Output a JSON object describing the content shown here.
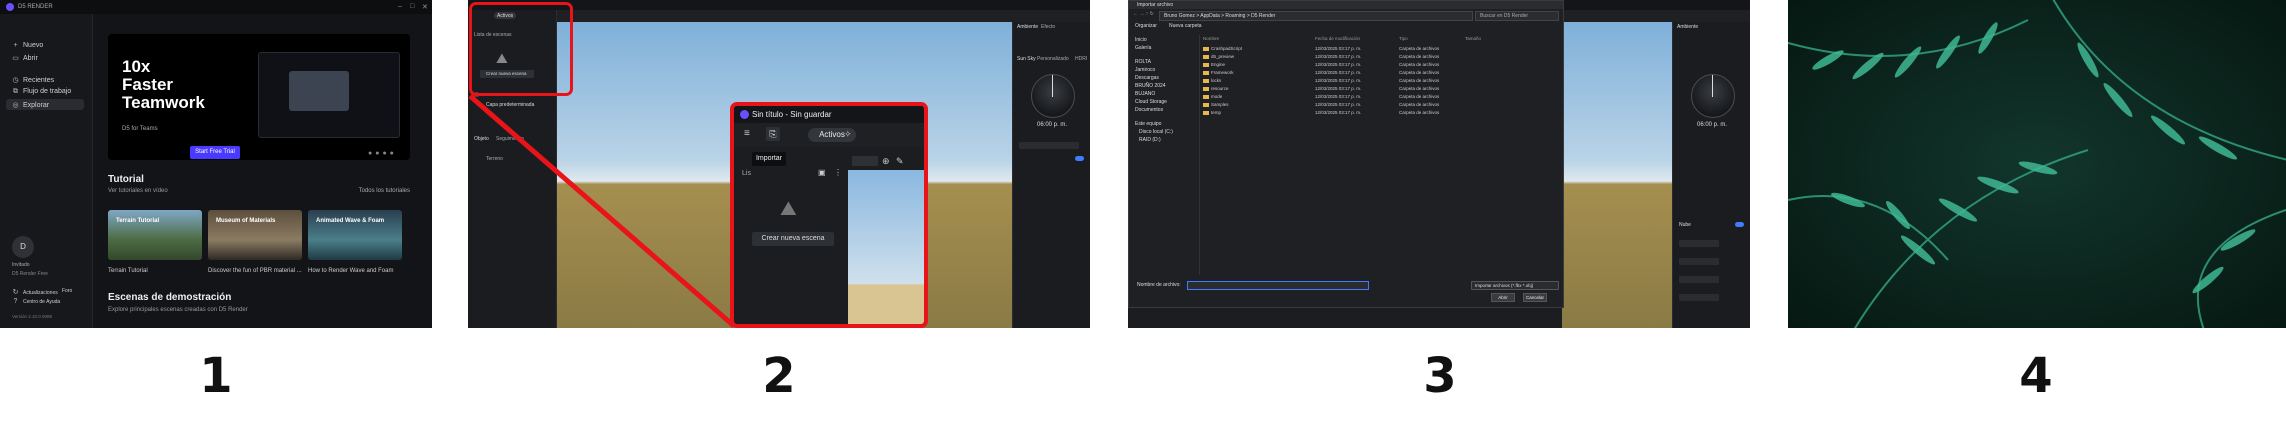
{
  "panel1": {
    "app_title": "D5 RENDER",
    "sidebar": {
      "nuevo": "Nuevo",
      "abrir": "Abrir",
      "recientes": "Recientes",
      "flujo": "Flujo de trabajo",
      "explorar": "Explorar",
      "user_initial": "D",
      "username": "Invitado",
      "plan": "D5 Render Free",
      "actualizaciones": "Actualizaciones",
      "foro": "Foro",
      "centro": "Centro de Ayuda",
      "version": "Versión 2.10.0.0089"
    },
    "banner": {
      "headline": "10x\nFaster\nTeamwork",
      "sub": "D5 for Teams",
      "button": "Start Free Trial"
    },
    "tutorial": {
      "title": "Tutorial",
      "subtitle": "Ver tutoriales en vídeo",
      "see_all": "Todos los tutoriales",
      "items": [
        {
          "thumb_label": "Terrain Tutorial",
          "caption": "Terrain Tutorial"
        },
        {
          "thumb_label": "Museum of Materials",
          "caption": "Discover the fun of PBR material ..."
        },
        {
          "thumb_label": "Animated Wave & Foam",
          "caption": "How to Render Wave and Foam"
        }
      ]
    },
    "demo": {
      "title": "Escenas de demostración",
      "subtitle": "Explore principales escenas creadas con D5 Render"
    }
  },
  "panel2": {
    "activos_small": "Activos",
    "lista_escenas": "Lista de escenas",
    "crear_small": "Crear nueva escena",
    "capa": "Capa predeterminada",
    "objeto": "Objeto",
    "seguimiento": "Seguimiento",
    "terreno": "Terreno",
    "ambiente": "Ambiente",
    "efecto": "Efecto",
    "cielo": "Sun Sky",
    "personalizado": "Personalizado",
    "hdri": "HDRI",
    "time": "06:00 p. m.",
    "zoom": {
      "title": "Sin título - Sin guardar",
      "activos": "Activos",
      "tooltip": "Importar",
      "lista": "Lis",
      "crear": "Crear nueva escena"
    }
  },
  "panel3": {
    "dialog_title": "Importar archivo",
    "path": "Bruno Gomez > AppData > Roaming > D5 Render",
    "search": "Buscar en D5 Render",
    "organize": "Organizar",
    "new_folder": "Nueva carpeta",
    "headers": [
      "Nombre",
      "Fecha de modificación",
      "Tipo",
      "Tamaño"
    ],
    "nav_items": [
      "Inicio",
      "Galería",
      "ROLTA",
      "Jamiroco",
      "Descargas",
      "BRUÑO 2024",
      "BUJANO",
      "Cloud Storage",
      "Documentos",
      "Este equipo",
      "Disco local (C:)",
      "RAID (D:)"
    ],
    "files": [
      {
        "name": "CrashpadScript",
        "date": "12/03/2025 03:17 p. m.",
        "type": "Carpeta de archivos"
      },
      {
        "name": "d5_preview",
        "date": "12/03/2025 03:17 p. m.",
        "type": "Carpeta de archivos"
      },
      {
        "name": "Engine",
        "date": "12/03/2025 03:17 p. m.",
        "type": "Carpeta de archivos"
      },
      {
        "name": "Framework",
        "date": "12/03/2025 03:17 p. m.",
        "type": "Carpeta de archivos"
      },
      {
        "name": "locks",
        "date": "12/03/2025 03:17 p. m.",
        "type": "Carpeta de archivos"
      },
      {
        "name": "resource",
        "date": "12/03/2025 03:17 p. m.",
        "type": "Carpeta de archivos"
      },
      {
        "name": "mode",
        "date": "12/03/2025 03:17 p. m.",
        "type": "Carpeta de archivos"
      },
      {
        "name": "Samples",
        "date": "12/03/2025 03:17 p. m.",
        "type": "Carpeta de archivos"
      },
      {
        "name": "temp",
        "date": "12/03/2025 03:17 p. m.",
        "type": "Carpeta de archivos"
      }
    ],
    "filename_label": "Nombre de archivo:",
    "filetype": "Importar archivos (*.fbx *.obj)",
    "open": "Abrir",
    "cancel": "Cancelar",
    "time": "06:00 p. m.",
    "nube": "Nube",
    "ambiente": "Ambiente"
  },
  "labels": [
    "1",
    "2",
    "3",
    "4"
  ]
}
